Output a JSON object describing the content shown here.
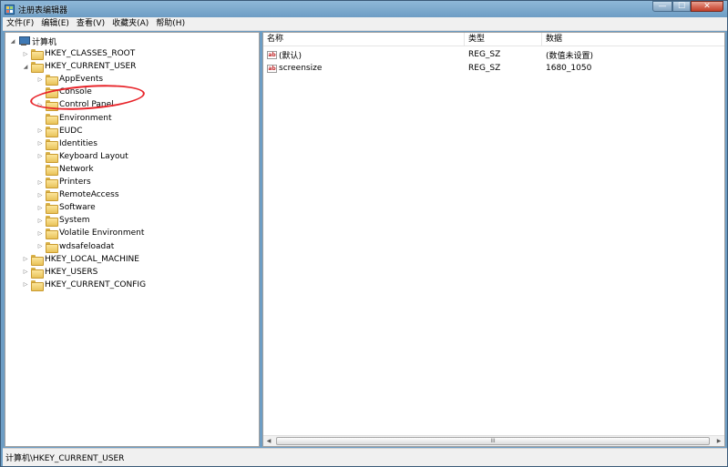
{
  "window": {
    "title": "注册表编辑器",
    "minimize_glyph": "—",
    "maximize_glyph": "☐",
    "close_glyph": "✕"
  },
  "menu": [
    "文件(F)",
    "编辑(E)",
    "查看(V)",
    "收藏夹(A)",
    "帮助(H)"
  ],
  "tree": {
    "root": "计算机",
    "items": [
      {
        "label": "HKEY_CLASSES_ROOT",
        "level": 1,
        "expander": "▷"
      },
      {
        "label": "HKEY_CURRENT_USER",
        "level": 1,
        "expander": "◢",
        "selected": true
      },
      {
        "label": "AppEvents",
        "level": 2,
        "expander": "▷"
      },
      {
        "label": "Console",
        "level": 2,
        "expander": ""
      },
      {
        "label": "Control Panel",
        "level": 2,
        "expander": "▷"
      },
      {
        "label": "Environment",
        "level": 2,
        "expander": ""
      },
      {
        "label": "EUDC",
        "level": 2,
        "expander": "▷"
      },
      {
        "label": "Identities",
        "level": 2,
        "expander": "▷"
      },
      {
        "label": "Keyboard Layout",
        "level": 2,
        "expander": "▷"
      },
      {
        "label": "Network",
        "level": 2,
        "expander": ""
      },
      {
        "label": "Printers",
        "level": 2,
        "expander": "▷"
      },
      {
        "label": "RemoteAccess",
        "level": 2,
        "expander": "▷"
      },
      {
        "label": "Software",
        "level": 2,
        "expander": "▷"
      },
      {
        "label": "System",
        "level": 2,
        "expander": "▷"
      },
      {
        "label": "Volatile Environment",
        "level": 2,
        "expander": "▷"
      },
      {
        "label": "wdsafeloadat",
        "level": 2,
        "expander": "▷"
      },
      {
        "label": "HKEY_LOCAL_MACHINE",
        "level": 1,
        "expander": "▷"
      },
      {
        "label": "HKEY_USERS",
        "level": 1,
        "expander": "▷"
      },
      {
        "label": "HKEY_CURRENT_CONFIG",
        "level": 1,
        "expander": "▷"
      }
    ],
    "root_expander": "◢"
  },
  "list": {
    "columns": [
      "名称",
      "类型",
      "数据"
    ],
    "value_icon": "ab",
    "rows": [
      {
        "name": "(默认)",
        "type": "REG_SZ",
        "data": "(数值未设置)"
      },
      {
        "name": "screensize",
        "type": "REG_SZ",
        "data": "1680_1050"
      }
    ]
  },
  "scrollbar": {
    "left_arrow": "◀",
    "right_arrow": "▶",
    "grip": "III"
  },
  "status": "计算机\\HKEY_CURRENT_USER",
  "colors": {
    "highlight_ring": "#e8242a",
    "folder": "#e9c35a"
  }
}
